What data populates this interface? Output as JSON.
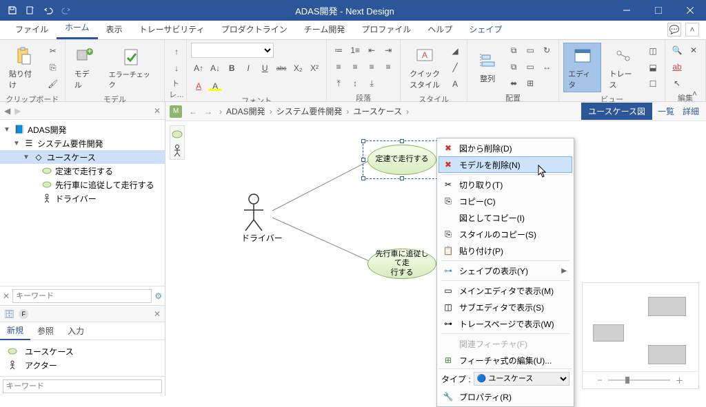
{
  "titlebar": {
    "title": "ADAS開発 - Next Design"
  },
  "tabs": {
    "file": "ファイル",
    "home": "ホーム",
    "view": "表示",
    "trace": "トレーサビリティ",
    "product": "プロダクトライン",
    "team": "チーム開発",
    "profile": "プロファイル",
    "help": "ヘルプ",
    "shape": "シェイプ"
  },
  "ribbon": {
    "clipboard": {
      "paste": "貼り付け",
      "group": "クリップボード"
    },
    "model": {
      "model": "モデル",
      "error": "エラーチェック",
      "group": "モデル"
    },
    "trace": {
      "group": "トレ…"
    },
    "font": {
      "group": "フォント",
      "bold": "B",
      "italic": "I",
      "underline": "U",
      "strike": "abc"
    },
    "paragraph": {
      "group": "段落"
    },
    "style": {
      "quick": "クイック\nスタイル",
      "group": "スタイル"
    },
    "arrange": {
      "align": "整列",
      "group": "配置"
    },
    "view": {
      "editor": "エディタ",
      "trace": "トレース",
      "group": "ビュー"
    },
    "edit": {
      "group": "編集"
    }
  },
  "tree": {
    "root": "ADAS開発",
    "node1": "システム要件開発",
    "node2": "ユースケース",
    "leaf1": "定速で走行する",
    "leaf2": "先行車に追従して走行する",
    "leaf3": "ドライバー",
    "search_ph": "キーワード"
  },
  "bottom": {
    "tab_new": "新規",
    "tab_ref": "参照",
    "tab_in": "入力",
    "item_uc": "ユースケース",
    "item_actor": "アクター",
    "search_ph": "キーワード"
  },
  "breadcrumb": {
    "b1": "ADAS開発",
    "b2": "システム要件開発",
    "b3": "ユースケース"
  },
  "header_links": {
    "view_btn": "ユースケース図",
    "list": "一覧",
    "detail": "詳細"
  },
  "canvas": {
    "uc1": "定速で走行する",
    "uc2": "先行車に追従して走\n行する",
    "actor": "ドライバー"
  },
  "context_menu": {
    "remove_diagram": "図から削除(D)",
    "delete_model": "モデルを削除(N)",
    "cut": "切り取り(T)",
    "copy": "コピー(C)",
    "copy_as_diagram": "図としてコピー(I)",
    "copy_style": "スタイルのコピー(S)",
    "paste": "貼り付け(P)",
    "shape_display": "シェイプの表示(Y)",
    "main_editor": "メインエディタで表示(M)",
    "sub_editor": "サブエディタで表示(S)",
    "trace_page": "トレースページで表示(W)",
    "related_feature": "関連フィーチャ(F)",
    "feature_expr": "フィーチャ式の編集(U)...",
    "type_label": "タイプ :",
    "type_value": "ユースケース",
    "property": "プロパティ(R)"
  }
}
